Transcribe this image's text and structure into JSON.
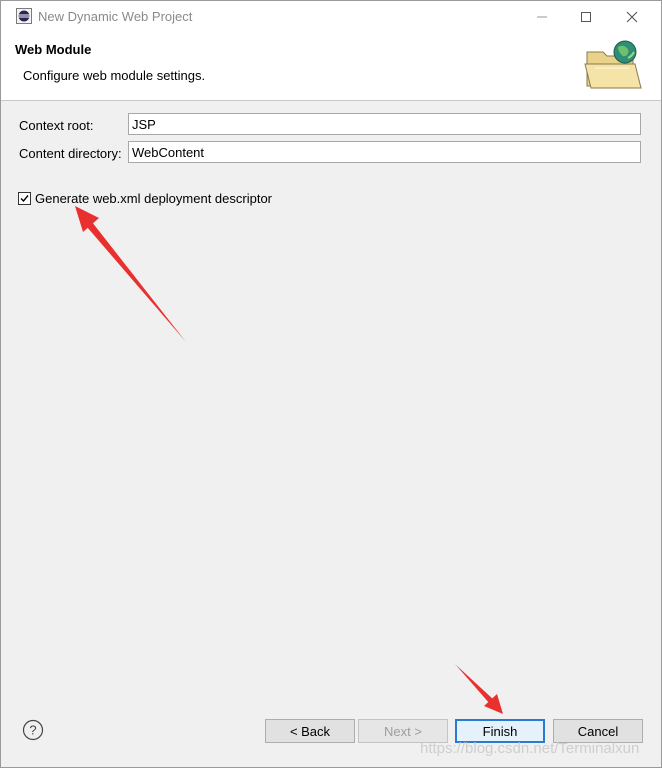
{
  "window": {
    "title": "New Dynamic Web Project"
  },
  "header": {
    "title": "Web Module",
    "description": "Configure web module settings."
  },
  "form": {
    "context_root_label": "Context root:",
    "context_root_value": "JSP",
    "content_directory_label": "Content directory:",
    "content_directory_value": "WebContent",
    "generate_descriptor_label": "Generate web.xml deployment descriptor",
    "generate_descriptor_checked": true
  },
  "buttons": {
    "back": "< Back",
    "next": "Next >",
    "finish": "Finish",
    "cancel": "Cancel"
  },
  "watermark": "https://blog.csdn.net/Terminalxun",
  "colors": {
    "annotation_arrow": "#e8312f",
    "finish_border": "#2a7ad3"
  }
}
